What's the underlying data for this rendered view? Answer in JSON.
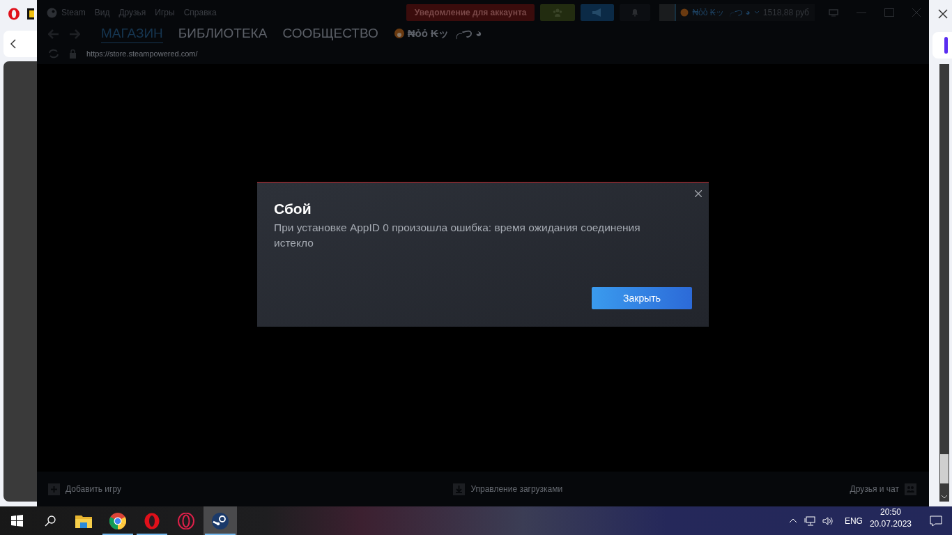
{
  "steam": {
    "menu": [
      "Steam",
      "Вид",
      "Друзья",
      "Игры",
      "Справка"
    ],
    "account_alert": "Уведомление для аккаунта",
    "username": "₦ỏỏ ₭ッ ╭つ ◕",
    "balance": "1518,88 руб",
    "nav_tabs": [
      {
        "label": "МАГАЗИН",
        "selected": true
      },
      {
        "label": "БИБЛИОТЕКА",
        "selected": false
      },
      {
        "label": "СООБЩЕСТВО",
        "selected": false
      },
      {
        "label": "₦ỏỏ ₭ッ ╭つ ◕",
        "selected": false
      }
    ],
    "url": "https://store.steampowered.com/",
    "footer": {
      "add_game": "Добавить игру",
      "downloads": "Управление загрузками",
      "friends": "Друзья и чат"
    }
  },
  "dialog": {
    "title": "Сбой",
    "message": "При установке AppID 0 произошла ошибка: время ожидания соединения истекло",
    "button": "Закрыть"
  },
  "taskbar": {
    "apps": [
      {
        "kind": "folder",
        "running": false,
        "selected": false
      },
      {
        "kind": "chrome",
        "running": true,
        "selected": false
      },
      {
        "kind": "opera",
        "running": true,
        "selected": false
      },
      {
        "kind": "operagx",
        "running": false,
        "selected": false
      },
      {
        "kind": "steam",
        "running": true,
        "selected": true
      }
    ],
    "language": "ENG",
    "time": "20:50",
    "date": "20.07.2023"
  }
}
